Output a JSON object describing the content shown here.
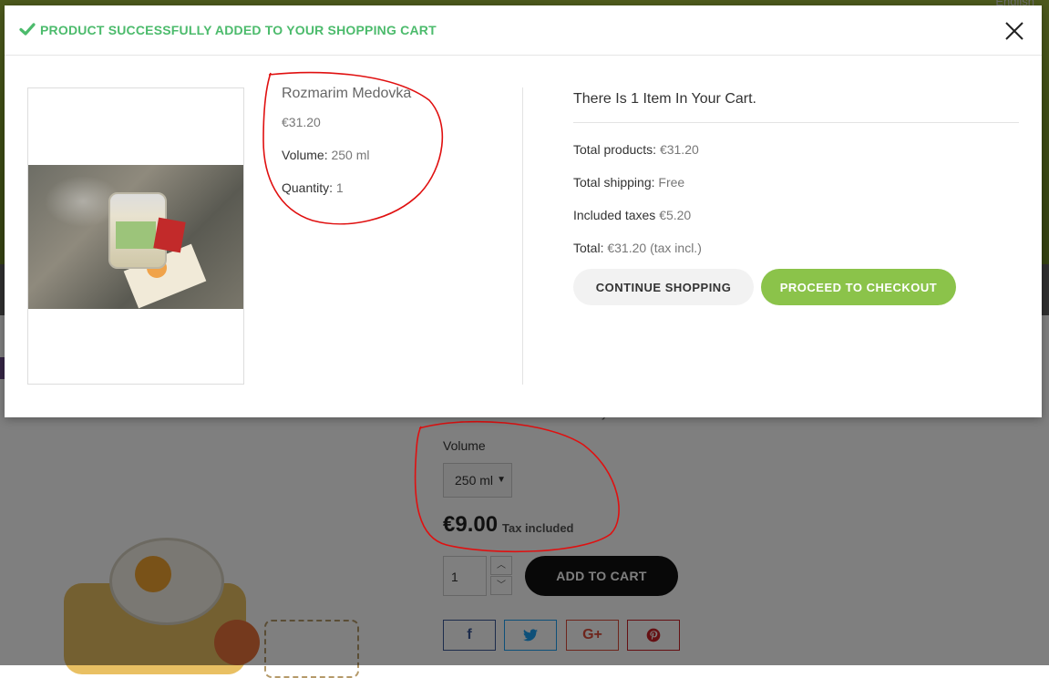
{
  "background_page": {
    "language": "English",
    "volume_label": "Volume",
    "volume_selected": "250 ml",
    "price": "€9.00",
    "tax_note": "Tax included",
    "quantity": "1",
    "add_to_cart_label": "ADD TO CART",
    "share": {
      "facebook": "f",
      "twitter": "t",
      "googleplus": "G+",
      "pinterest": "P"
    }
  },
  "modal": {
    "title": "PRODUCT SUCCESSFULLY ADDED TO YOUR SHOPPING CART",
    "product": {
      "name": "Rozmarim Medovka",
      "price": "€31.20",
      "volume_label": "Volume:",
      "volume_value": "250 ml",
      "quantity_label": "Quantity:",
      "quantity_value": "1"
    },
    "cart": {
      "title": "There Is 1 Item In Your Cart.",
      "total_products_label": "Total products:",
      "total_products_value": "€31.20",
      "total_shipping_label": "Total shipping:",
      "total_shipping_value": "Free",
      "included_taxes_label": "Included taxes",
      "included_taxes_value": "€5.20",
      "total_label": "Total:",
      "total_value": "€31.20 (tax incl.)"
    },
    "buttons": {
      "continue": "CONTINUE SHOPPING",
      "checkout": "PROCEED TO CHECKOUT"
    }
  },
  "colors": {
    "success_green": "#4cbb6c",
    "checkout_green": "#8bc34a",
    "annotation_red": "#e01010"
  },
  "icons": {
    "check": "check-icon",
    "close": "close-icon",
    "qty_up": "chevron-up-icon",
    "qty_down": "chevron-down-icon"
  }
}
